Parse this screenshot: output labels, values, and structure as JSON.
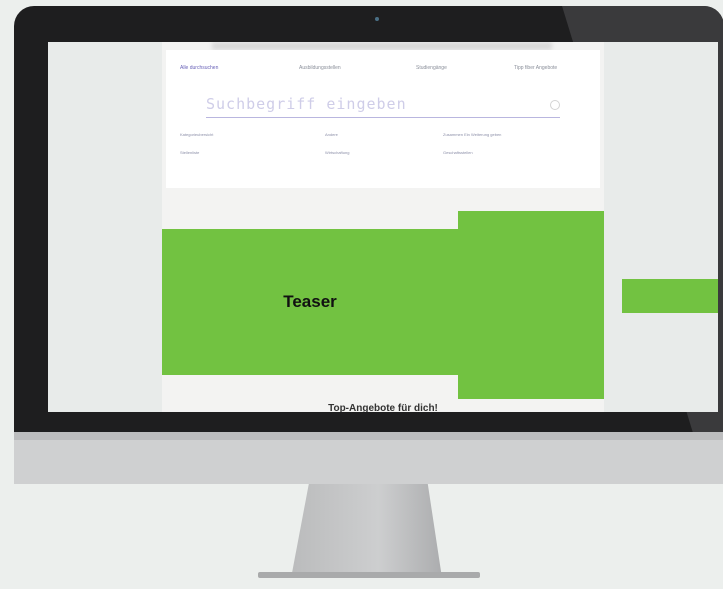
{
  "tabs": [
    {
      "label": "Alle durchsuchen",
      "active": true
    },
    {
      "label": "Ausbildungsstellen",
      "active": false
    },
    {
      "label": "Studiengänge",
      "active": false
    },
    {
      "label": "Tipp fiber Angebote",
      "active": false
    }
  ],
  "search": {
    "placeholder": "Suchbegriff eingeben"
  },
  "quick_links": [
    [
      "Kategorieubersicht",
      "Andere",
      "Zusammen Ein Weiterung geben"
    ],
    [
      "Stellenliste",
      "Wirtschaftung",
      "Geschaftsstellen"
    ]
  ],
  "teaser": {
    "label": "Teaser"
  },
  "offers": {
    "title": "Top-Angebote für dich!"
  },
  "colors": {
    "teaser_green": "#72c241",
    "accent_purple": "#6a63b8",
    "monitor_bezel": "#1e1e1f"
  }
}
